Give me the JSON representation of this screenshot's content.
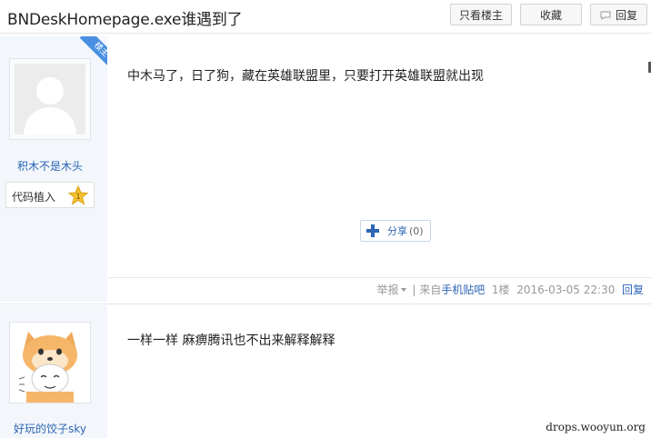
{
  "header": {
    "title": "BNDeskHomepage.exe谁遇到了",
    "buttons": {
      "only_op": "只看楼主",
      "favorite": "收藏",
      "reply": "回复"
    }
  },
  "posts": [
    {
      "op_badge": "楼主",
      "username": "积木不是木头",
      "badge_label": "代码植入",
      "badge_level": "1",
      "content": "中木马了，日了狗，藏在英雄联盟里，只要打开英雄联盟就出现",
      "share_label": "分享",
      "share_count": "(0)",
      "footer": {
        "report": "举报",
        "divider": "|",
        "source_prefix": "来自",
        "source_link": "手机贴吧",
        "floor": "1楼",
        "timestamp": "2016-03-05 22:30",
        "reply": "回复"
      }
    },
    {
      "username": "好玩的饺子sky",
      "content": "一样一样 麻痹腾讯也不出来解释解释"
    }
  ],
  "watermark": "drops.wooyun.org",
  "colors": {
    "link": "#2d64b3",
    "sidebar_bg": "#f3f7fc",
    "op_ribbon": "#4a90e2",
    "badge_star": "#f5c12e"
  }
}
